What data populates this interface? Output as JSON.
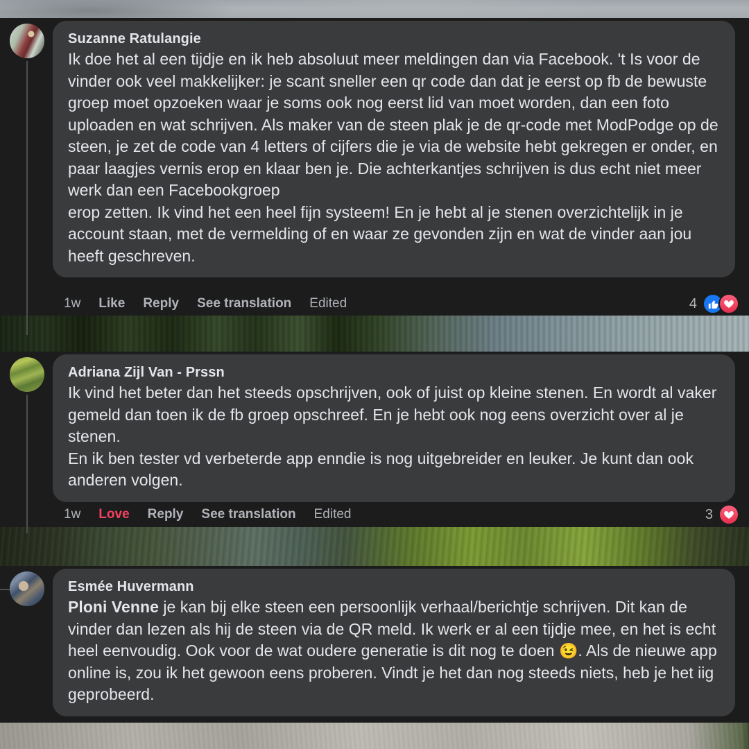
{
  "background": {
    "top_strip": "cloudy-grey-sky-photo",
    "mid_strip_1": "pine-forest-landscape-photo",
    "mid_strip_2": "marsh-wetland-water-photo",
    "bottom_strip": "pale-stone-surface-photo"
  },
  "comments": [
    {
      "author": "Suzanne Ratulangie",
      "avatar": "suzanne-avatar",
      "text": "Ik doe het al een tijdje en ik heb absoluut meer meldingen dan via Facebook. 't Is voor de vinder ook veel makkelijker: je scant sneller een qr code dan dat je eerst op fb de bewuste groep moet opzoeken waar je soms ook nog eerst lid van moet worden, dan een foto uploaden en wat schrijven. Als maker van de steen plak je de qr-code met ModPodge op de steen, je zet de code van 4 letters of cijfers die je via de website hebt gekregen er onder, en paar laagjes vernis erop en klaar ben je. Die achterkantjes schrijven is dus echt niet meer werk dan een Facebookgroep\nerop zetten. Ik vind het een heel fijn systeem! En je hebt al je stenen overzichtelijk in je account staan, met de vermelding of en waar ze gevonden zijn en wat de vinder aan jou heeft geschreven.",
      "actions": {
        "time": "1w",
        "like": "Like",
        "reply": "Reply",
        "translate": "See translation",
        "edited": "Edited"
      },
      "reactions": {
        "count": "4",
        "badges": [
          "like-icon",
          "love-heart-icon"
        ]
      }
    },
    {
      "author": "Adriana Zijl Van - Prssn",
      "avatar": "adriana-avatar",
      "text": "Ik vind het beter dan het steeds opschrijven, ook of juist op kleine stenen. En wordt al vaker gemeld dan toen ik de fb groep opschreef. En je hebt ook nog eens overzicht over al je stenen.\nEn ik ben tester vd verbeterde app enndie is nog uitgebreider en leuker. Je kunt dan ook anderen volgen.",
      "actions": {
        "time": "1w",
        "like": "Love",
        "reply": "Reply",
        "translate": "See translation",
        "edited": "Edited"
      },
      "reactions": {
        "count": "3",
        "badges": [
          "love-heart-icon"
        ]
      }
    },
    {
      "author": "Esmée Huvermann",
      "avatar": "esmee-avatar",
      "mention": "Ploni Venne",
      "text_part_1": " je kan bij elke steen een persoonlijk verhaal/berichtje schrijven. Dit kan de vinder dan lezen als hij de steen via de QR meld. Ik werk er al een tijdje mee, en het is echt heel eenvoudig. Ook voor de wat oudere generatie is dit nog te doen ",
      "emoji": "😉",
      "text_part_2": ". Als de nieuwe app online is, zou ik het gewoon eens proberen. Vindt je het dan nog steeds niets, heb je het iig geprobeerd."
    }
  ],
  "colors": {
    "bubble": "#3a3b3c",
    "page_background": "#1c1c1d",
    "primary_text": "#e4e6eb",
    "secondary_text": "#b0b3b8",
    "love_accent": "#f3425f",
    "like_accent": "#1877f2"
  }
}
